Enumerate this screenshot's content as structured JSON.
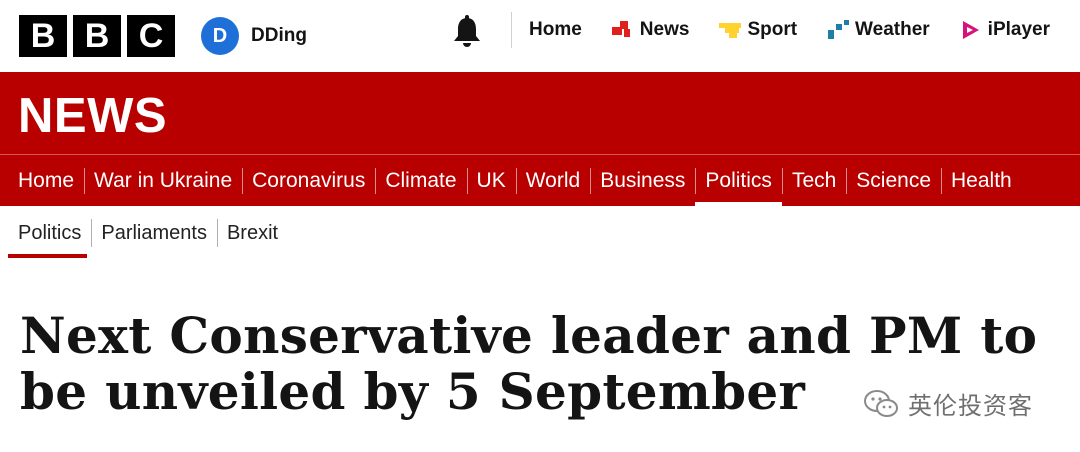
{
  "branding": {
    "letters": [
      "B",
      "B",
      "C"
    ]
  },
  "account": {
    "initial": "D",
    "name": "DDing"
  },
  "global_nav": [
    {
      "label": "Home"
    },
    {
      "label": "News"
    },
    {
      "label": "Sport"
    },
    {
      "label": "Weather"
    },
    {
      "label": "iPlayer"
    }
  ],
  "masthead": {
    "title": "NEWS"
  },
  "section_nav": [
    {
      "label": "Home"
    },
    {
      "label": "War in Ukraine"
    },
    {
      "label": "Coronavirus"
    },
    {
      "label": "Climate"
    },
    {
      "label": "UK"
    },
    {
      "label": "World"
    },
    {
      "label": "Business"
    },
    {
      "label": "Politics",
      "active": true
    },
    {
      "label": "Tech"
    },
    {
      "label": "Science"
    },
    {
      "label": "Health"
    }
  ],
  "sub_nav": [
    {
      "label": "Politics",
      "active": true
    },
    {
      "label": "Parliaments"
    },
    {
      "label": "Brexit"
    }
  ],
  "headline": {
    "line1": "Next Conservative leader and PM to",
    "line2": "be unveiled by 5 September"
  },
  "watermark": {
    "text": "英伦投资客"
  },
  "colors": {
    "brand_red": "#b80000",
    "avatar_blue": "#1f6fd8",
    "news_icon": "#e0201b",
    "sport_icon": "#ffd230",
    "weather_icon": "#1d7fa8",
    "iplayer_icon": "#d6127c"
  }
}
